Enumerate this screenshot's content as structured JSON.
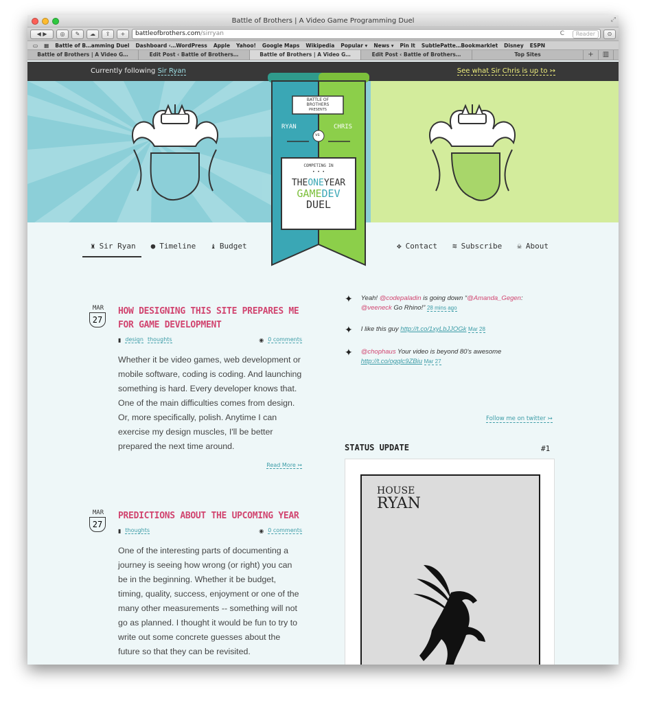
{
  "window": {
    "title": "Battle of Brothers | A Video Game Programming Duel"
  },
  "toolbar": {
    "url_host": "battleofbrothers.com",
    "url_path": "/sirryan",
    "reader": "Reader"
  },
  "bookmarks": [
    "Battle of B…amming Duel",
    "Dashboard ‹…WordPress",
    "Apple",
    "Yahoo!",
    "Google Maps",
    "Wikipedia",
    "Popular ▾",
    "News ▾",
    "Pin It",
    "SubtlePatte…Bookmarklet",
    "Disney",
    "ESPN"
  ],
  "tabs": [
    "Battle of Brothers | A Video G…",
    "Edit Post ‹ Battle of Brothers…",
    "Battle of Brothers | A Video G…",
    "Edit Post ‹ Battle of Brothers…",
    "Top Sites"
  ],
  "topbar": {
    "following_prefix": "Currently following",
    "following_name": "Sir Ryan",
    "see_other": "See what Sir Chris is up to ↣"
  },
  "banner": {
    "brand_top": "BATTLE OF",
    "brand_bottom": "BROTHERS",
    "presents": "PRESENTS",
    "left": "RYAN",
    "vs": "vs",
    "right": "CHRIS",
    "competing": "COMPETING IN",
    "dots": "• • •",
    "line1_a": "THE",
    "line1_b": "ONE",
    "line1_c": "YEAR",
    "line2_a": "GAME",
    "line2_b": "DEV",
    "line3": "DUEL"
  },
  "nav_left": [
    {
      "label": "Sir Ryan",
      "icon": "castle-icon"
    },
    {
      "label": "Timeline",
      "icon": "bomb-icon"
    },
    {
      "label": "Budget",
      "icon": "money-bag-icon"
    }
  ],
  "nav_right": [
    {
      "label": "Contact",
      "icon": "game-controller-icon"
    },
    {
      "label": "Subscribe",
      "icon": "rss-icon"
    },
    {
      "label": "About",
      "icon": "skull-icon"
    }
  ],
  "posts": [
    {
      "month": "MAR",
      "day": "27",
      "title": "How designing this site prepares me for game development",
      "tags": [
        "design",
        "thoughts"
      ],
      "comments": "0 comments",
      "body": "Whether it be video games, web development or mobile software, coding is coding. And launching something is hard. Every developer knows that. One of the main difficulties comes from design. Or, more specifically, polish. Anytime I can exercise my design muscles, I'll be better prepared the next time around.",
      "read_more": "Read More ↣"
    },
    {
      "month": "MAR",
      "day": "27",
      "title": "Predictions about the upcoming year",
      "tags": [
        "thoughts"
      ],
      "comments": "0 comments",
      "body": "One of the interesting parts of documenting a journey is seeing how wrong (or right) you can be in the beginning. Whether it be budget, timing, quality, success, enjoyment or one of the many other measurements -- something will not go as planned. I thought it would be fun to try to write out some concrete guesses about the future so that they can be revisited."
    }
  ],
  "tweets": [
    {
      "pre": "Yeah! ",
      "mention1": "@codepaladin",
      "mid": " is going down “",
      "mention2": "@Amanda_Gegen",
      "mid2": ": ",
      "mention3": "@veeneck",
      "post": " Go Rhino!”",
      "time": "28 mins ago"
    },
    {
      "text": "I like this guy ",
      "link": "http://t.co/1xyLbJJOGk",
      "time": "Mar 28"
    },
    {
      "mention": "@chophaus",
      "text": " Your video is beyond 80's awesome ",
      "link": "http://t.co/ogqlc9ZBiu",
      "time": "Mar 27"
    }
  ],
  "follow_twitter": "Follow me on twitter ↣",
  "status": {
    "title": "STATUS UPDATE",
    "number": "#1",
    "card_line1": "HOUSE",
    "card_line2": "RYAN"
  },
  "colors": {
    "teal": "#8ccfd8",
    "lime": "#d3ec9c",
    "pink": "#d14570",
    "link": "#3c9ca7",
    "dark": "#383838"
  }
}
